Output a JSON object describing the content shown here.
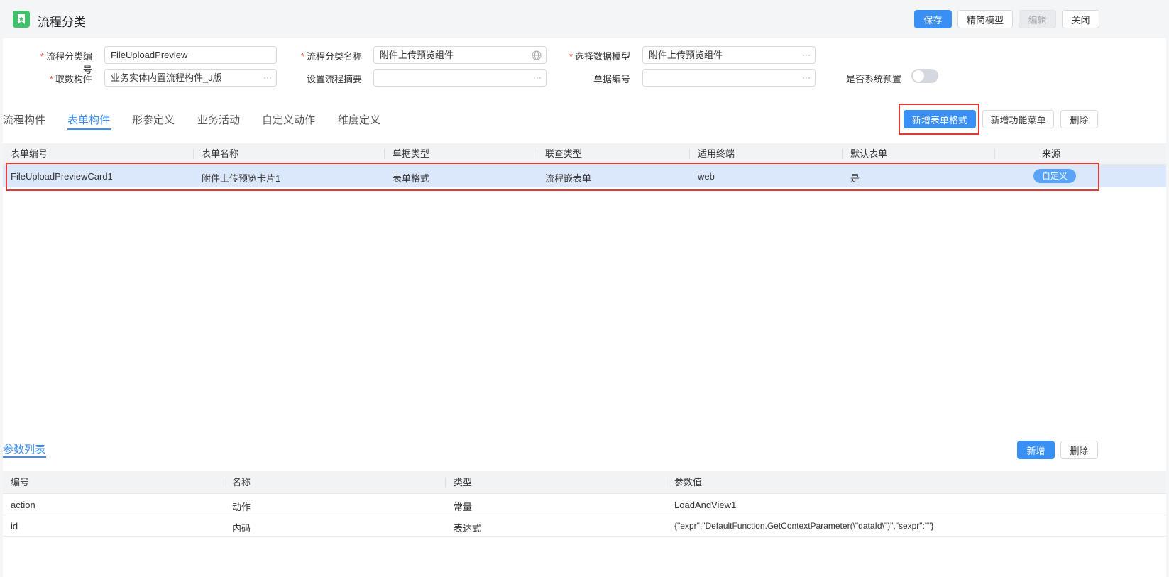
{
  "header": {
    "title": "流程分类",
    "buttons": {
      "save": "保存",
      "simplify": "精简模型",
      "edit": "编辑",
      "close": "关闭"
    }
  },
  "form": {
    "category_code": {
      "label": "流程分类编号",
      "value": "FileUploadPreview",
      "required": true
    },
    "category_name": {
      "label": "流程分类名称",
      "value": "附件上传预览组件",
      "required": true
    },
    "data_model": {
      "label": "选择数据模型",
      "value": "附件上传预览组件",
      "required": true
    },
    "fetch_component": {
      "label": "取数构件",
      "value": "业务实体内置流程构件_J版",
      "required": true
    },
    "flow_summary": {
      "label": "设置流程摘要",
      "value": ""
    },
    "doc_number": {
      "label": "单据编号",
      "value": ""
    },
    "system_preset": {
      "label": "是否系统预置",
      "checked": false
    }
  },
  "tabs": [
    {
      "label": "流程构件",
      "active": false
    },
    {
      "label": "表单构件",
      "active": true
    },
    {
      "label": "形参定义",
      "active": false
    },
    {
      "label": "业务活动",
      "active": false
    },
    {
      "label": "自定义动作",
      "active": false
    },
    {
      "label": "维度定义",
      "active": false
    }
  ],
  "form_toolbar": {
    "add_form_format": "新增表单格式",
    "add_function_menu": "新增功能菜单",
    "delete": "删除"
  },
  "form_table": {
    "columns": [
      "表单编号",
      "表单名称",
      "单据类型",
      "联查类型",
      "适用终端",
      "默认表单",
      "来源"
    ],
    "rows": [
      {
        "code": "FileUploadPreviewCard1",
        "name": "附件上传预览卡片1",
        "doc_type": "表单格式",
        "link_type": "流程嵌表单",
        "terminal": "web",
        "default": "是",
        "source": "自定义"
      }
    ]
  },
  "params": {
    "title": "参数列表",
    "add": "新增",
    "delete": "删除",
    "columns": [
      "编号",
      "名称",
      "类型",
      "参数值"
    ],
    "rows": [
      {
        "code": "action",
        "name": "动作",
        "type": "常量",
        "value": "LoadAndView1"
      },
      {
        "code": "id",
        "name": "内码",
        "type": "表达式",
        "value": "{\"expr\":\"DefaultFunction.GetContextParameter(\\\"dataId\\\")\",\"sexpr\":\"\"}"
      }
    ]
  },
  "colors": {
    "primary": "#3a8ff5",
    "highlight_box": "#e53935",
    "selected_row": "#dbe8fb",
    "app_icon": "#3fc06b"
  }
}
